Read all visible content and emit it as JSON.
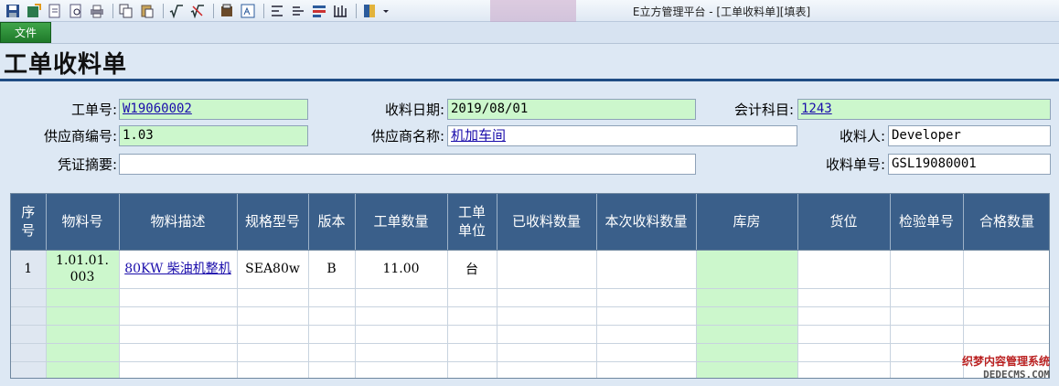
{
  "app": {
    "title": "E立方管理平台 - [工单收料单][填表]"
  },
  "toolbar": {
    "icons": [
      "save-icon",
      "save-as-icon",
      "export-icon",
      "preview-icon",
      "print-icon",
      "copy-icon",
      "paste-icon",
      "formula-icon",
      "formula-clear-icon",
      "stamp-icon",
      "report-icon",
      "insert-row-icon",
      "delete-row-icon",
      "fill-icon",
      "columns-icon",
      "book-icon",
      "dropdown-icon"
    ]
  },
  "menu": {
    "file_label": "文件"
  },
  "page": {
    "title": "工单收料单"
  },
  "form": {
    "work_order_label": "工单号:",
    "work_order_value": "W19060002",
    "receive_date_label": "收料日期:",
    "receive_date_value": "2019/08/01",
    "account_label": "会计科目:",
    "account_value": "1243",
    "supplier_code_label": "供应商编号:",
    "supplier_code_value": "1.03",
    "supplier_name_label": "供应商名称:",
    "supplier_name_value": "机加车间",
    "receiver_label": "收料人:",
    "receiver_value": "Developer",
    "voucher_label": "凭证摘要:",
    "voucher_value": "",
    "receipt_no_label": "收料单号:",
    "receipt_no_value": "GSL19080001"
  },
  "grid": {
    "headers": [
      "序号",
      "物料号",
      "物料描述",
      "规格型号",
      "版本",
      "工单数量",
      "工单单位",
      "已收料数量",
      "本次收料数量",
      "库房",
      "货位",
      "检验单号",
      "合格数量"
    ],
    "rows": [
      {
        "seq": "1",
        "material_no": "1.01.01.003",
        "description": "80KW 柴油机整机",
        "spec": "SEA80w",
        "version": "B",
        "wo_qty": "11.00",
        "unit": "台",
        "received_qty": "",
        "this_qty": "",
        "warehouse": "",
        "location": "",
        "inspection_no": "",
        "qualified_qty": ""
      }
    ]
  },
  "watermark": {
    "line1": "织梦内容管理系统",
    "line2": "DEDECMS.COM"
  },
  "colors": {
    "header_bg": "#3a5f8a",
    "required_bg": "#ccf7cc",
    "title_rule": "#1f4c84",
    "file_tab": "#2a8a35"
  }
}
